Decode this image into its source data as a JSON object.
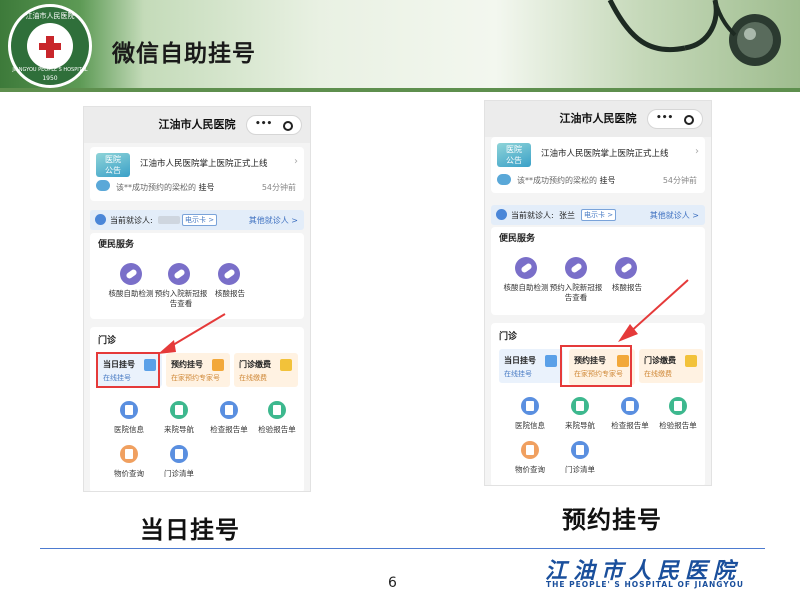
{
  "slide": {
    "title": "微信自助挂号",
    "logo_text": "江油市人民医院",
    "logo_en": "JIANGYOU PEOPLE'S HOSPITAL",
    "logo_year": "1950",
    "page_number": "6",
    "footer_cn": "江油市人民医院",
    "footer_en": "THE PEOPLE' S HOSPITAL OF JIANGYOU"
  },
  "colors": {
    "accent_green": "#3d7a3a",
    "highlight_red": "#e53a3a",
    "brand_blue": "#1a4f9c"
  },
  "screens": [
    {
      "caption": "当日挂号",
      "app_title": "江油市人民医院",
      "capsule_dots": "•••",
      "notice_tag_top": "医院",
      "notice_tag_bottom": "公告",
      "notice_text": "江油市人民医院掌上医院正式上线",
      "message_prefix": "该**成功预约的梁松的",
      "message_action": "挂号",
      "message_time": "54分钟前",
      "visitor_label": "当前就诊人:",
      "visitor_name": "",
      "card_badge": "电示卡 >",
      "others_link": "其他就诊人 >",
      "services_title": "便民服务",
      "services": [
        "核酸自助检测",
        "预约入院新冠报告查看",
        "核酸报告"
      ],
      "outpatient_title": "门诊",
      "tiles": [
        {
          "title": "当日挂号",
          "sub": "在线挂号"
        },
        {
          "title": "预约挂号",
          "sub": "在家预约专家号"
        },
        {
          "title": "门诊缴费",
          "sub": "在线缴费"
        }
      ],
      "grid_items": [
        "医院信息",
        "来院导航",
        "检查报告单",
        "检验报告单",
        "物价查询",
        "门诊清单"
      ],
      "highlighted_tile": "当日挂号"
    },
    {
      "caption": "预约挂号",
      "app_title": "江油市人民医院",
      "capsule_dots": "•••",
      "notice_tag_top": "医院",
      "notice_tag_bottom": "公告",
      "notice_text": "江油市人民医院掌上医院正式上线",
      "message_prefix": "该**成功预约的梁松的",
      "message_action": "挂号",
      "message_time": "54分钟前",
      "visitor_label": "当前就诊人:",
      "visitor_name": "张兰",
      "card_badge": "电示卡 >",
      "others_link": "其他就诊人 >",
      "services_title": "便民服务",
      "services": [
        "核酸自助检测",
        "预约入院新冠报告查看",
        "核酸报告"
      ],
      "outpatient_title": "门诊",
      "tiles": [
        {
          "title": "当日挂号",
          "sub": "在线挂号"
        },
        {
          "title": "预约挂号",
          "sub": "在家预约专家号"
        },
        {
          "title": "门诊缴费",
          "sub": "在线缴费"
        }
      ],
      "grid_items": [
        "医院信息",
        "来院导航",
        "检查报告单",
        "检验报告单",
        "物价查询",
        "门诊清单"
      ],
      "highlighted_tile": "预约挂号"
    }
  ]
}
